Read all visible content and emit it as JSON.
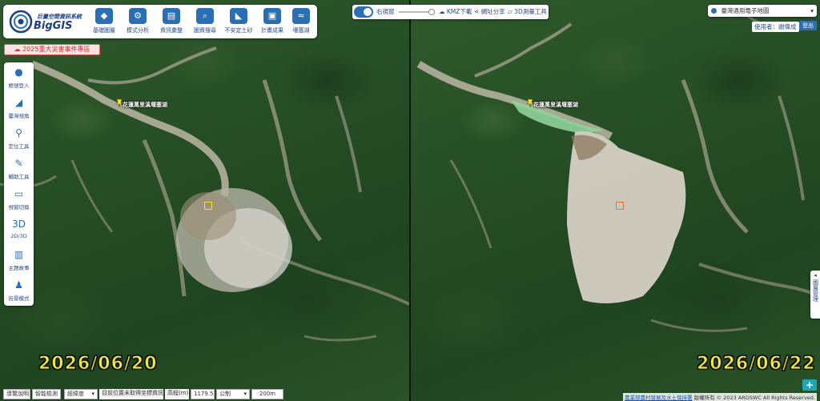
{
  "header": {
    "logo_chinese": "巨量空間資訊系統",
    "logo_english": "BigGIS",
    "tools": [
      {
        "label": "基礎圖層",
        "icon": "layers-icon"
      },
      {
        "label": "模式分析",
        "icon": "analysis-icon"
      },
      {
        "label": "資訊彙整",
        "icon": "document-icon"
      },
      {
        "label": "圖資搜尋",
        "icon": "search-map-icon"
      },
      {
        "label": "不安定土砂",
        "icon": "landslide-icon"
      },
      {
        "label": "計畫成果",
        "icon": "image-icon"
      },
      {
        "label": "堰塞湖",
        "icon": "lake-icon"
      }
    ]
  },
  "event_button": {
    "label": "2025重大災害事件專區"
  },
  "sidebar": {
    "items": [
      {
        "label": "帳號登入",
        "icon": "user-icon"
      },
      {
        "label": "臺灣視角",
        "icon": "taiwan-icon"
      },
      {
        "label": "定位工具",
        "icon": "location-pin-icon"
      },
      {
        "label": "輔助工具",
        "icon": "tools-icon"
      },
      {
        "label": "視窗切換",
        "icon": "window-icon"
      },
      {
        "label": "2D/3D",
        "icon": "3d-icon"
      },
      {
        "label": "主題故事",
        "icon": "book-icon"
      },
      {
        "label": "街景模式",
        "icon": "streetview-icon"
      }
    ]
  },
  "top_controls": {
    "compare_label": "右視窗",
    "kmz_label": "KMZ下載",
    "share_label": "網址分享",
    "measure_label": "3D測量工具"
  },
  "basemap": {
    "selected": "臺灣通用電子地圖"
  },
  "user": {
    "label": "使用者：",
    "name": "謝偉成",
    "logout_label": "登出"
  },
  "right_tab": {
    "label": "圖層管理"
  },
  "map": {
    "left_date": "2026/06/20",
    "right_date": "2026/06/22",
    "marker_label": "花蓮萬里溪堰塞湖"
  },
  "bottom_bar": {
    "help_label": "導覽說明",
    "detect_label": "智能檢測",
    "coord_select": "經緯度",
    "coord_text": "目前位置未取得坐標資訊",
    "elev_label": "高程(m)",
    "elev_value": "1179.5",
    "unit_select": "公制",
    "scale_label": "200m"
  },
  "footer": {
    "agency": "農業部農村發展及水土保持署",
    "copyright": "版權所有 © 2023 ARDSWC All Rights Reserved."
  },
  "colors": {
    "primary": "#2a6fb4",
    "date_yellow": "#f5e93a",
    "event_red": "#d23030",
    "plus_teal": "#1fa7b8"
  }
}
